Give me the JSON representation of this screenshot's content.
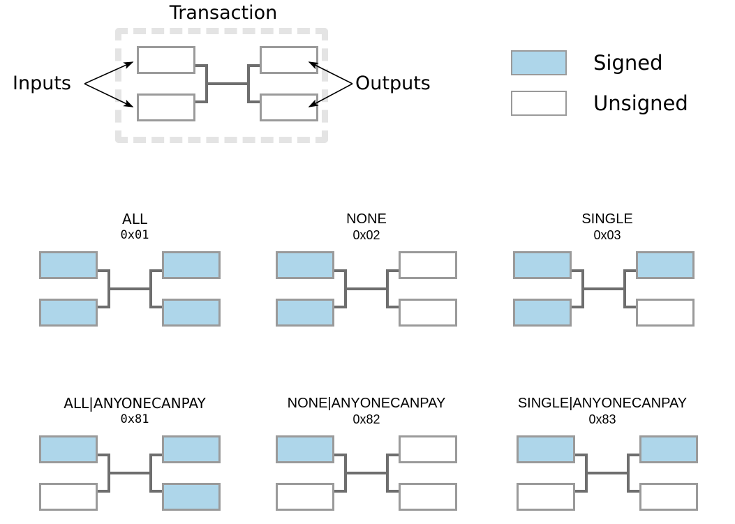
{
  "transaction": {
    "title": "Transaction",
    "inputs_label": "Inputs",
    "outputs_label": "Outputs",
    "inputs": [
      "unsigned",
      "unsigned"
    ],
    "outputs": [
      "unsigned",
      "unsigned"
    ]
  },
  "legend": {
    "signed": {
      "label": "Signed",
      "color": "#aed6ea"
    },
    "unsigned": {
      "label": "Unsigned",
      "color": "#ffffff"
    },
    "border_color": "#9a9a9a",
    "wire_color": "#6e6e6e",
    "dashed_box_color": "#e4e4e4"
  },
  "sighash_panels": [
    {
      "id": "all",
      "title": "ALL",
      "code": "0x01",
      "inputs": [
        "signed",
        "signed"
      ],
      "outputs": [
        "signed",
        "signed"
      ]
    },
    {
      "id": "none",
      "title": "NONE",
      "code": "0x02",
      "inputs": [
        "signed",
        "signed"
      ],
      "outputs": [
        "unsigned",
        "unsigned"
      ]
    },
    {
      "id": "single",
      "title": "SINGLE",
      "code": "0x03",
      "inputs": [
        "signed",
        "signed"
      ],
      "outputs": [
        "signed",
        "unsigned"
      ]
    },
    {
      "id": "all-acp",
      "title": "ALL|ANYONECANPAY",
      "code": "0x81",
      "inputs": [
        "signed",
        "unsigned"
      ],
      "outputs": [
        "signed",
        "signed"
      ]
    },
    {
      "id": "none-acp",
      "title": "NONE|ANYONECANPAY",
      "code": "0x82",
      "inputs": [
        "signed",
        "unsigned"
      ],
      "outputs": [
        "unsigned",
        "unsigned"
      ]
    },
    {
      "id": "single-acp",
      "title": "SINGLE|ANYONECANPAY",
      "code": "0x83",
      "inputs": [
        "signed",
        "unsigned"
      ],
      "outputs": [
        "signed",
        "unsigned"
      ]
    }
  ]
}
